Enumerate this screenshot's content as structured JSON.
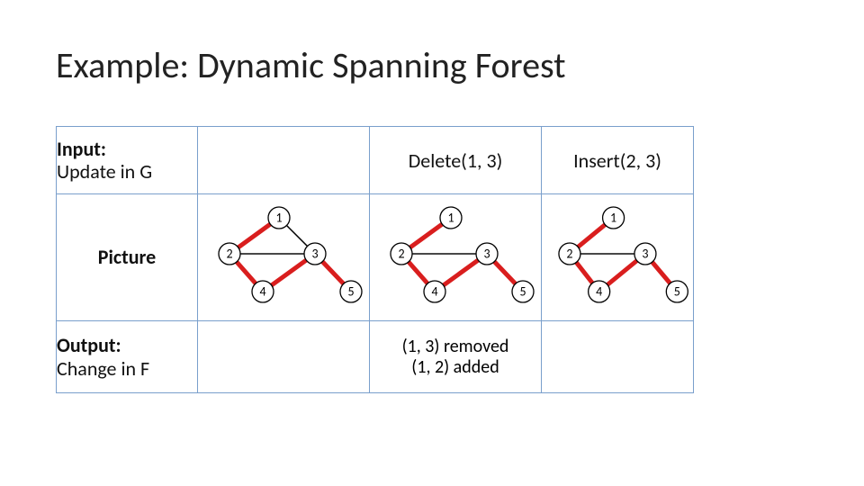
{
  "title": "Example: Dynamic Spanning Forest",
  "headers": {
    "input_bold": "Input:",
    "input_sub": "Update in G",
    "delete": "Delete(1, 3)",
    "insert": "Insert(2, 3)",
    "picture": "Picture",
    "output_bold": "Output:",
    "output_sub": "Change in F"
  },
  "output": {
    "line1": "(1, 3) removed",
    "line2": "(1, 2) added"
  },
  "chart_data": [
    {
      "type": "graph",
      "name": "initial",
      "nodes": [
        1,
        2,
        3,
        4,
        5
      ],
      "edges_plain": [
        [
          2,
          3
        ],
        [
          1,
          3
        ]
      ],
      "edges_tree": [
        [
          1,
          2
        ],
        [
          2,
          4
        ],
        [
          3,
          4
        ],
        [
          3,
          5
        ]
      ]
    },
    {
      "type": "graph",
      "name": "after_delete_1_3",
      "nodes": [
        1,
        2,
        3,
        4,
        5
      ],
      "edges_plain": [
        [
          2,
          3
        ]
      ],
      "edges_tree": [
        [
          1,
          2
        ],
        [
          2,
          4
        ],
        [
          3,
          4
        ],
        [
          3,
          5
        ]
      ]
    },
    {
      "type": "graph",
      "name": "after_insert_2_3",
      "nodes": [
        1,
        2,
        3,
        4,
        5
      ],
      "edges_plain": [
        [
          2,
          3
        ]
      ],
      "edges_tree": [
        [
          1,
          2
        ],
        [
          2,
          4
        ],
        [
          3,
          4
        ],
        [
          3,
          5
        ]
      ]
    }
  ],
  "node_labels": {
    "1": "1",
    "2": "2",
    "3": "3",
    "4": "4",
    "5": "5"
  }
}
